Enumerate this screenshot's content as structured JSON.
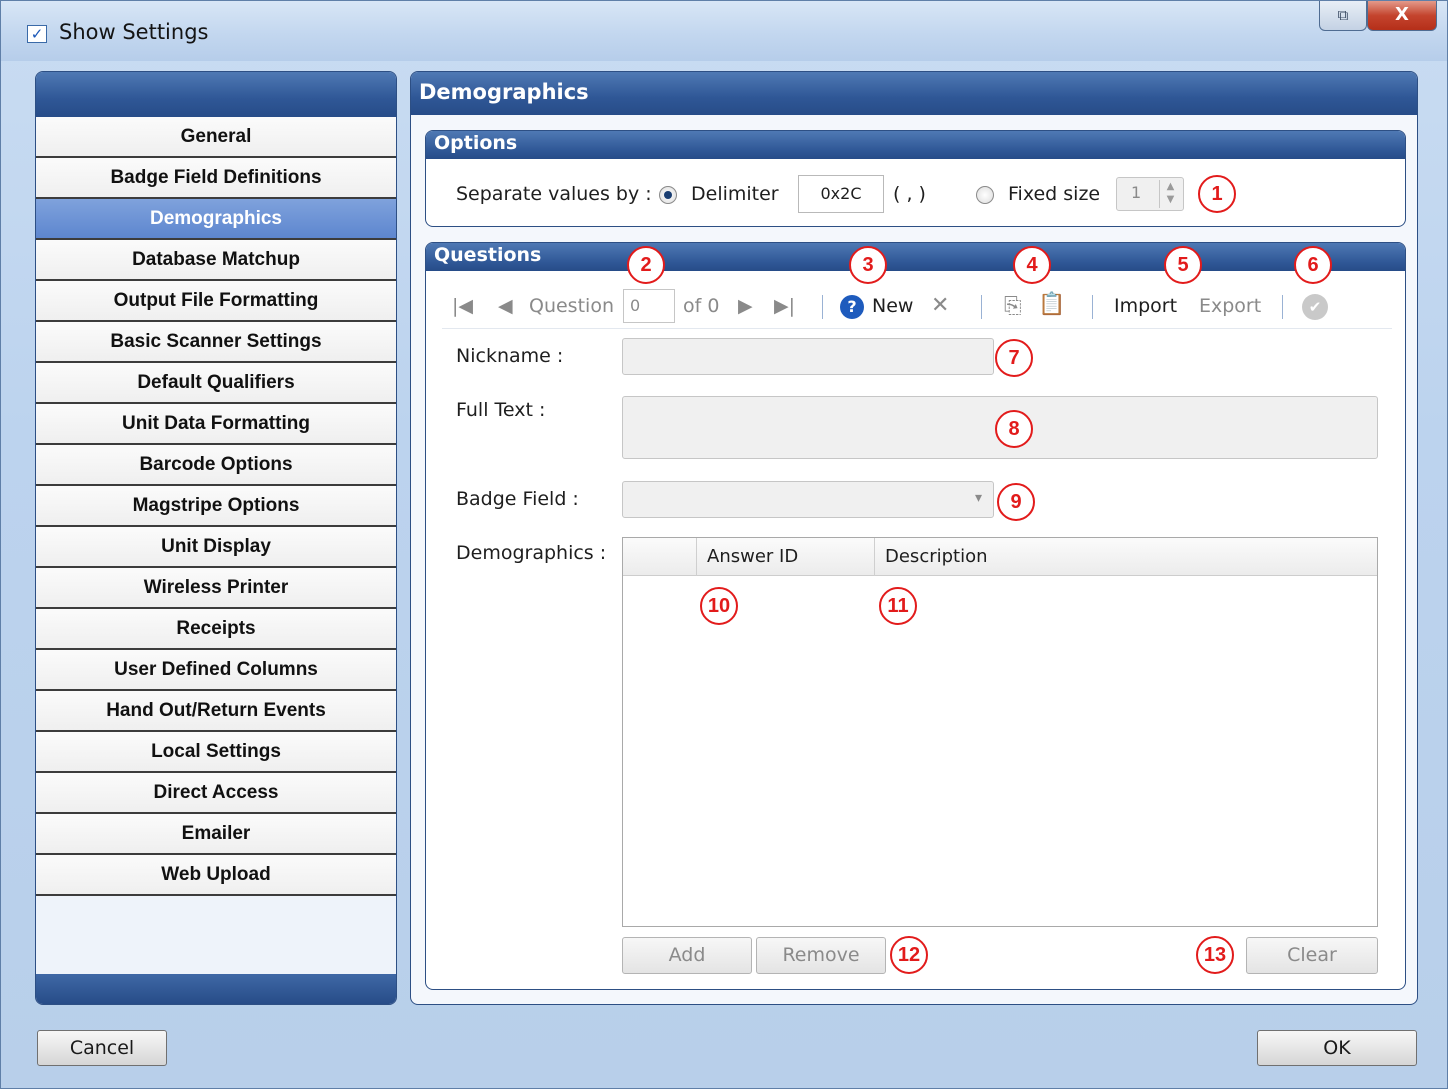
{
  "window": {
    "title": "Show Settings",
    "restore_glyph": "⧉",
    "close_glyph": "X",
    "title_icon_glyph": "✓"
  },
  "nav": {
    "active": "Demographics",
    "items": [
      "General",
      "Badge Field Definitions",
      "Demographics",
      "Database Matchup",
      "Output File Formatting",
      "Basic Scanner Settings",
      "Default Qualifiers",
      "Unit Data Formatting",
      "Barcode Options",
      "Magstripe Options",
      "Unit Display",
      "Wireless Printer",
      "Receipts",
      "User Defined Columns",
      "Hand Out/Return Events",
      "Local Settings",
      "Direct Access",
      "Emailer",
      "Web Upload"
    ]
  },
  "main": {
    "title": "Demographics",
    "options": {
      "title": "Options",
      "separate_label": "Separate values by :",
      "delimiter_label": "Delimiter",
      "delimiter_value": "0x2C",
      "delimiter_hint": "( , )",
      "fixed_size_label": "Fixed size",
      "fixed_size_value": "1",
      "delimiter_selected": true
    },
    "questions": {
      "title": "Questions",
      "toolbar": {
        "first_glyph": "|◀",
        "prev_glyph": "◀",
        "question_label": "Question",
        "question_value": "0",
        "of_label": "of 0",
        "next_glyph": "▶",
        "last_glyph": "▶|",
        "new_label": "New",
        "new_icon_glyph": "?",
        "delete_glyph": "✕",
        "copy_glyph": "⎘",
        "paste_glyph": "📋",
        "import_label": "Import",
        "export_label": "Export",
        "apply_glyph": "✔"
      },
      "nickname_label": "Nickname :",
      "full_text_label": "Full Text :",
      "badge_field_label": "Badge Field :",
      "badge_field_arrow": "▾",
      "demographics_label": "Demographics :",
      "grid_columns": [
        "",
        "Answer ID",
        "Description"
      ],
      "add_label": "Add",
      "remove_label": "Remove",
      "clear_label": "Clear"
    }
  },
  "footer": {
    "cancel_label": "Cancel",
    "ok_label": "OK"
  },
  "markers": [
    "1",
    "2",
    "3",
    "4",
    "5",
    "6",
    "7",
    "8",
    "9",
    "10",
    "11",
    "12",
    "13"
  ],
  "colors": {
    "header_blue": "#2f5796",
    "active_item": "#5d86cf",
    "marker_red": "#e21b1b"
  }
}
